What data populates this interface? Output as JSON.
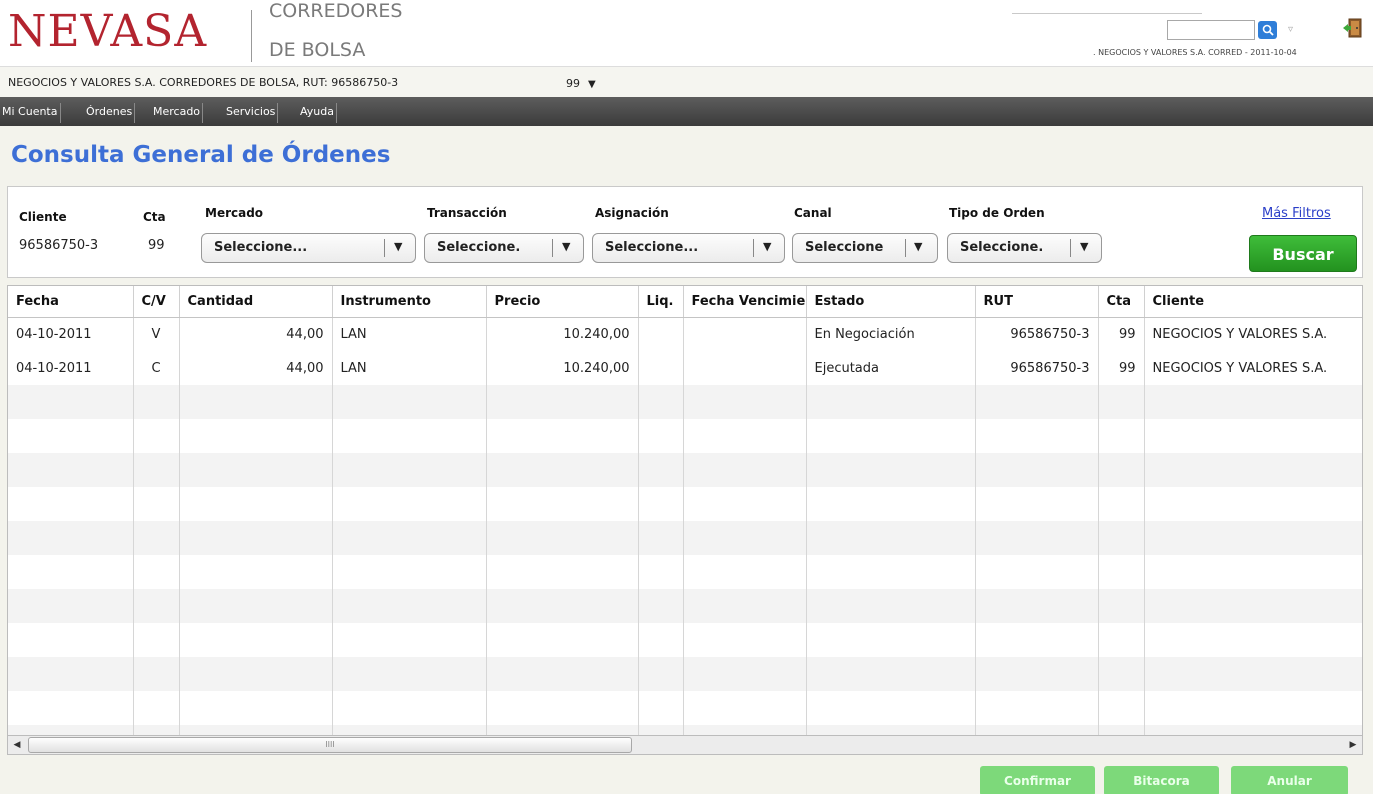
{
  "header": {
    "logo": "NEVASA",
    "logo_sub_1": "CORREDORES",
    "logo_sub_2": "DE BOLSA",
    "user_info": ". NEGOCIOS Y VALORES S.A. CORRED - 2011-10-04",
    "search_placeholder": ""
  },
  "account_bar": {
    "text": "NEGOCIOS Y VALORES S.A. CORREDORES DE BOLSA, RUT: 96586750-3",
    "selected_account": "99"
  },
  "menu": [
    "Mi Cuenta",
    "Órdenes",
    "Mercado",
    "Servicios",
    "Ayuda"
  ],
  "title": "Consulta General de Órdenes",
  "filters": {
    "cliente_label": "Cliente",
    "cliente_value": "96586750-3",
    "cta_label": "Cta",
    "cta_value": "99",
    "mercado_label": "Mercado",
    "mercado_value": "Seleccione...",
    "transaccion_label": "Transacción",
    "transaccion_value": "Seleccione.",
    "asignacion_label": "Asignación",
    "asignacion_value": "Seleccione...",
    "canal_label": "Canal",
    "canal_value": "Seleccione",
    "tipo_label": "Tipo de Orden",
    "tipo_value": "Seleccione.",
    "mas_filtros": "Más Filtros",
    "buscar": "Buscar"
  },
  "table": {
    "columns": [
      "Fecha",
      "C/V",
      "Cantidad",
      "Instrumento",
      "Precio",
      "Liq.",
      "Fecha Vencimiento",
      "Estado",
      "RUT",
      "Cta",
      "Cliente"
    ],
    "rows": [
      [
        "04-10-2011",
        "V",
        "44,00",
        "LAN",
        "10.240,00",
        "",
        "",
        "En Negociación",
        "96586750-3",
        "99",
        "NEGOCIOS Y VALORES S.A."
      ],
      [
        "04-10-2011",
        "C",
        "44,00",
        "LAN",
        "10.240,00",
        "",
        "",
        "Ejecutada",
        "96586750-3",
        "99",
        "NEGOCIOS Y VALORES S.A."
      ]
    ]
  },
  "scrollbar_grip": "IIII",
  "actions": {
    "confirmar": "Confirmar",
    "bitacora": "Bitacora",
    "anular": "Anular"
  }
}
